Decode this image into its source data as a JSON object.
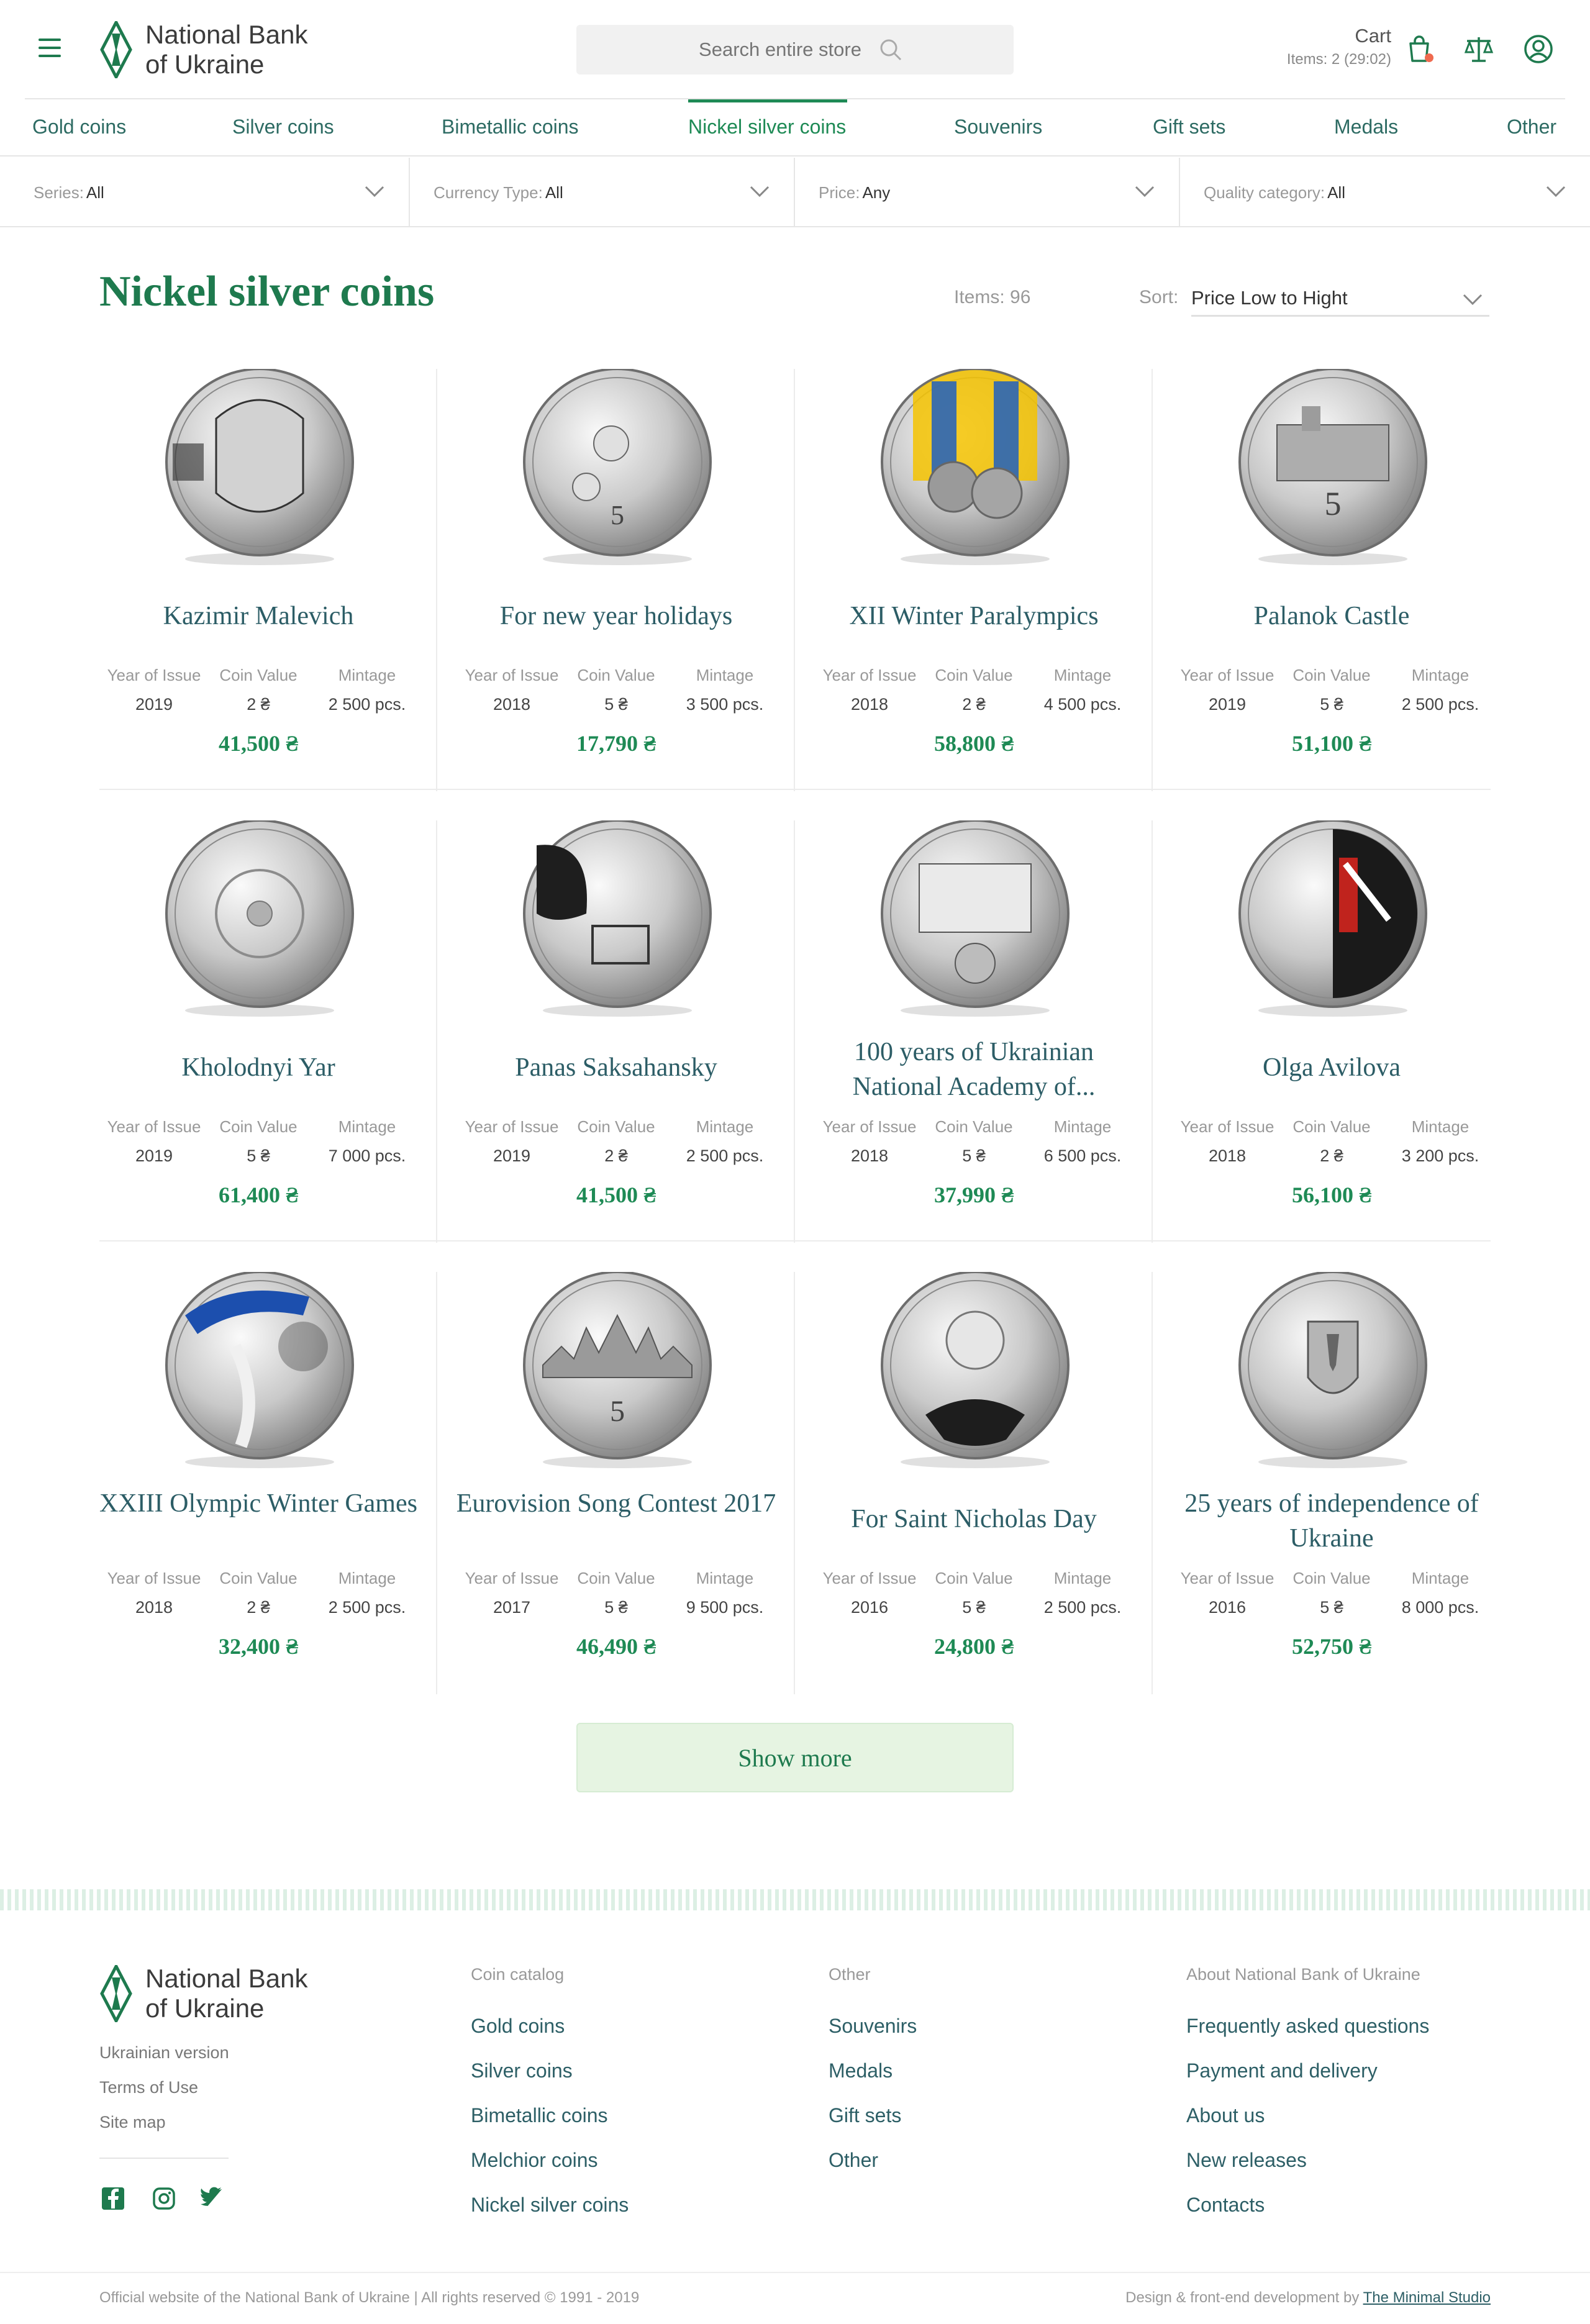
{
  "header": {
    "logo_text_line1": "National Bank",
    "logo_text_line2": "of Ukraine",
    "search_placeholder": "Search entire store",
    "cart_label": "Cart",
    "cart_items": "Items: 2 (29:02)"
  },
  "colors": {
    "brand_green": "#1e7a4e",
    "price_green": "#1e8a55",
    "text_teal": "#2c5d66",
    "button_bg": "#e6f4e2",
    "cart_dot": "#ef6a4f"
  },
  "categories": [
    {
      "label": "Gold coins"
    },
    {
      "label": "Silver coins"
    },
    {
      "label": "Bimetallic coins"
    },
    {
      "label": "Nickel silver coins",
      "active": true
    },
    {
      "label": "Souvenirs"
    },
    {
      "label": "Gift sets"
    },
    {
      "label": "Medals"
    },
    {
      "label": "Other"
    }
  ],
  "filters": [
    {
      "label": "Series:",
      "value": "All"
    },
    {
      "label": "Currency Type:",
      "value": "All"
    },
    {
      "label": "Price:",
      "value": "Any"
    },
    {
      "label": "Quality category:",
      "value": "All"
    }
  ],
  "listing": {
    "title": "Nickel silver coins",
    "items_count": "Items: 96",
    "sort_label": "Sort:",
    "sort_value": "Price Low to Hight",
    "meta_labels": {
      "year": "Year of Issue",
      "value": "Coin Value",
      "mintage": "Mintage"
    }
  },
  "products": [
    {
      "name": "Kazimir Malevich",
      "year": "2019",
      "value": "2 ₴",
      "mintage": "2 500 pcs.",
      "price": "41,500 ₴",
      "coin_style": "portrait"
    },
    {
      "name": "For new year holidays",
      "year": "2018",
      "value": "5 ₴",
      "mintage": "3 500 pcs.",
      "price": "17,790 ₴",
      "coin_style": "angels"
    },
    {
      "name": "XII Winter Paralympics",
      "year": "2018",
      "value": "2 ₴",
      "mintage": "4 500 pcs.",
      "price": "58,800 ₴",
      "coin_style": "color-flag"
    },
    {
      "name": "Palanok Castle",
      "year": "2019",
      "value": "5 ₴",
      "mintage": "2 500 pcs.",
      "price": "51,100 ₴",
      "coin_style": "castle"
    },
    {
      "name": "Kholodnyi Yar",
      "year": "2019",
      "value": "5 ₴",
      "mintage": "7 000 pcs.",
      "price": "61,400 ₴",
      "coin_style": "plain"
    },
    {
      "name": "Panas Saksahansky",
      "year": "2019",
      "value": "2 ₴",
      "mintage": "2 500 pcs.",
      "price": "41,500 ₴",
      "coin_style": "theatre"
    },
    {
      "name": "100 years of Ukrainian National Academy of...",
      "year": "2018",
      "value": "5 ₴",
      "mintage": "6 500 pcs.",
      "price": "37,990 ₴",
      "coin_style": "document"
    },
    {
      "name": "Olga Avilova",
      "year": "2018",
      "value": "2 ₴",
      "mintage": "3 200 pcs.",
      "price": "56,100 ₴",
      "coin_style": "dark-red"
    },
    {
      "name": "XXIII Olympic Winter Games",
      "year": "2018",
      "value": "2 ₴",
      "mintage": "2 500 pcs.",
      "price": "32,400 ₴",
      "coin_style": "blue-olympic"
    },
    {
      "name": "Eurovision Song Contest 2017",
      "year": "2017",
      "value": "5 ₴",
      "mintage": "9 500 pcs.",
      "price": "46,490 ₴",
      "coin_style": "city"
    },
    {
      "name": "For Saint Nicholas Day",
      "year": "2016",
      "value": "5 ₴",
      "mintage": "2 500 pcs.",
      "price": "24,800 ₴",
      "coin_style": "saint"
    },
    {
      "name": "25 years of independence of Ukraine",
      "year": "2016",
      "value": "5 ₴",
      "mintage": "8 000 pcs.",
      "price": "52,750 ₴",
      "coin_style": "emblem"
    }
  ],
  "show_more": "Show more",
  "footer": {
    "logo_text_line1": "National Bank",
    "logo_text_line2": "of Ukraine",
    "small_links": [
      "Ukrainian version",
      "Terms of Use",
      "Site map"
    ],
    "columns": [
      {
        "heading": "Coin catalog",
        "links": [
          "Gold coins",
          "Silver coins",
          "Bimetallic coins",
          "Melchior coins",
          "Nickel silver coins"
        ]
      },
      {
        "heading": "Other",
        "links": [
          "Souvenirs",
          "Medals",
          "Gift sets",
          "Other"
        ]
      },
      {
        "heading": "About National Bank of Ukraine",
        "links": [
          "Frequently asked questions",
          "Payment and delivery",
          "About us",
          "New releases",
          "Contacts"
        ]
      }
    ],
    "social": [
      "facebook-icon",
      "instagram-icon",
      "twitter-icon"
    ],
    "copyright": "Official website of the National Bank of Ukraine | All rights reserved © 1991 - 2019",
    "credits_prefix": "Design & front-end development by ",
    "credits_link": "The Minimal Studio"
  }
}
